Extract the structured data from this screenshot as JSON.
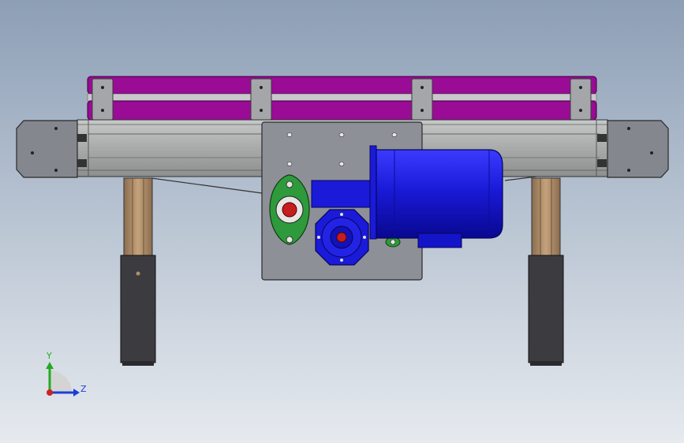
{
  "triad": {
    "y_label": "Y",
    "z_label": "Z",
    "y_color": "#22aa22",
    "z_color": "#1a3fd6",
    "origin_color": "#cc2222"
  },
  "colors": {
    "belt": "#9a0b96",
    "belt_gap": "#c8c8cc",
    "frame": "#a9abab",
    "plate": "#8e9097",
    "end_cap": "#85878e",
    "motor": "#1414c8",
    "motor_dark": "#0a0a8a",
    "bearing": "#2e9a3b",
    "shaft": "#c41e1e",
    "leg_upper": "#b0906c",
    "leg_lower": "#3c3c40",
    "background_top": "#8d9fb6",
    "background_bottom": "#e6eaef"
  },
  "component_icons": [
    "belt-icon",
    "frame-icon",
    "motor-icon",
    "bearing-icon",
    "gearbox-icon",
    "leg-icon",
    "axis-triad-icon"
  ]
}
